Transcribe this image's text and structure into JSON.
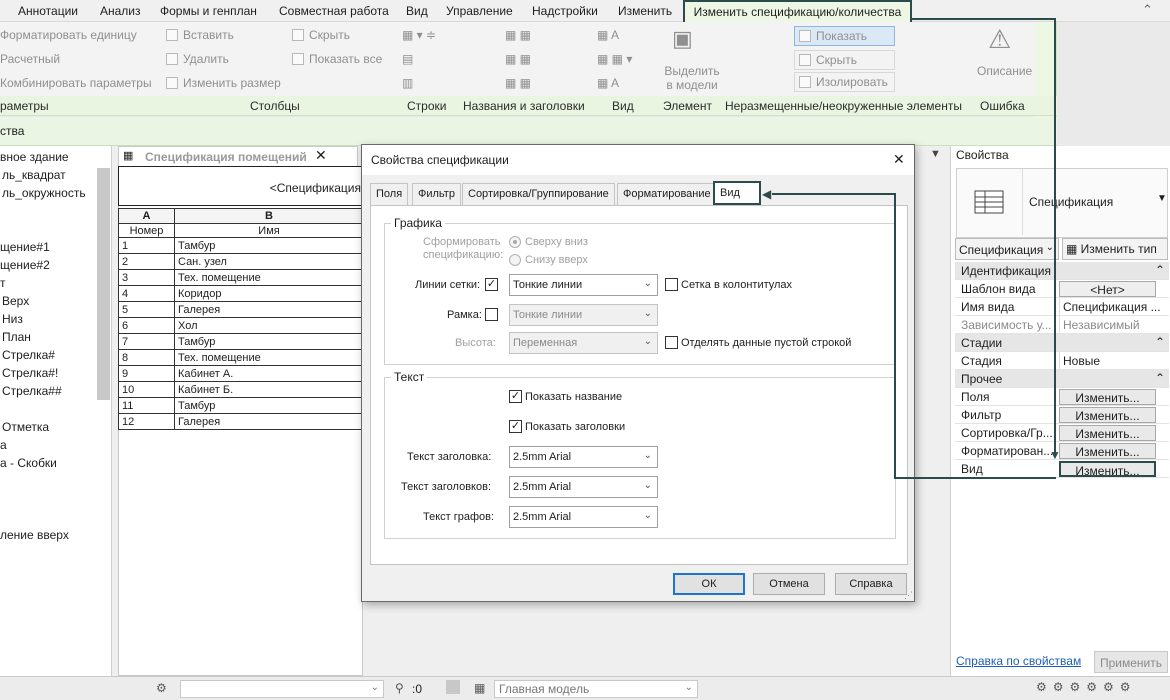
{
  "menu": {
    "items": [
      "Аннотации",
      "Анализ",
      "Формы и генплан",
      "Совместная работа",
      "Вид",
      "Управление",
      "Надстройки",
      "Изменить"
    ],
    "active": "Изменить спецификацию/количества"
  },
  "ribbon": {
    "params": [
      "Форматировать единицу",
      "Расчетный",
      "Комбинировать параметры"
    ],
    "columns": [
      "Вставить",
      "Удалить",
      "Изменить размер"
    ],
    "columns2": [
      "Скрыть",
      "Показать все"
    ],
    "element": "Выделить в модели",
    "unplaced": [
      "Показать",
      "Скрыть",
      "Изолировать"
    ],
    "error": "Описание",
    "group_labels": [
      "раметры",
      "Столбцы",
      "Строки",
      "Названия и заголовки",
      "Вид",
      "Элемент",
      "Неразмещенные/неокруженные элементы",
      "Ошибка"
    ],
    "context": "ства"
  },
  "left_panel": {
    "items": [
      "вное здание",
      "ль_квадрат",
      "ль_окружность",
      "щение#1",
      "щение#2",
      "т",
      "Верх",
      "Низ",
      "План",
      "Стрелка#",
      "Стрелка#!",
      "Стрелка##",
      "Отметка",
      "а",
      "а - Скобки",
      "ление вверх"
    ]
  },
  "schedule": {
    "tab_label": "Спецификация помещений",
    "title": "<Спецификация",
    "col_letters": [
      "A",
      "B"
    ],
    "col_headers": [
      "Номер",
      "Имя"
    ],
    "rows": [
      [
        "1",
        "Тамбур"
      ],
      [
        "2",
        "Сан. узел"
      ],
      [
        "3",
        "Тех. помещение"
      ],
      [
        "4",
        "Коридор"
      ],
      [
        "5",
        "Галерея"
      ],
      [
        "6",
        "Хол"
      ],
      [
        "7",
        "Тамбур"
      ],
      [
        "8",
        "Тех. помещение"
      ],
      [
        "9",
        "Кабинет А."
      ],
      [
        "10",
        "Кабинет Б."
      ],
      [
        "11",
        "Тамбур"
      ],
      [
        "12",
        "Галерея"
      ]
    ]
  },
  "dialog": {
    "title": "Свойства спецификации",
    "tabs": [
      "Поля",
      "Фильтр",
      "Сортировка/Группирование",
      "Форматирование",
      "Вид"
    ],
    "active_tab": "Вид",
    "graphics": {
      "group": "Графика",
      "build_label": "Сформировать спецификацию:",
      "build_top": "Сверху вниз",
      "build_bottom": "Снизу вверх",
      "grid_label": "Линии сетки:",
      "grid_value": "Тонкие линии",
      "grid_headers": "Сетка в колонтитулах",
      "frame_label": "Рамка:",
      "frame_value": "Тонкие линии",
      "height_label": "Высота:",
      "height_value": "Переменная",
      "blank_row": "Отделять данные пустой строкой"
    },
    "text": {
      "group": "Текст",
      "show_title": "Показать название",
      "show_headers": "Показать заголовки",
      "title_text_label": "Текст заголовка:",
      "title_text_value": "2.5mm Arial",
      "headers_text_label": "Текст заголовков:",
      "headers_text_value": "2.5mm Arial",
      "body_text_label": "Текст графов:",
      "body_text_value": "2.5mm Arial"
    },
    "buttons": {
      "ok": "ОК",
      "cancel": "Отмена",
      "help": "Справка"
    }
  },
  "properties": {
    "title": "Свойства",
    "type_name": "Спецификация",
    "type_selector": "Спецификация",
    "edit_type": "Изменить тип",
    "groups": {
      "identity": "Идентификация",
      "stages": "Стадии",
      "other": "Прочее"
    },
    "rows": {
      "template_k": "Шаблон вида",
      "template_v": "<Нет>",
      "viewname_k": "Имя вида",
      "viewname_v": "Спецификация ...",
      "depend_k": "Зависимость у...",
      "depend_v": "Независимый",
      "stage_k": "Стадия",
      "stage_v": "Новые",
      "fields_k": "Поля",
      "filter_k": "Фильтр",
      "sort_k": "Сортировка/Гр...",
      "format_k": "Форматирован...",
      "view_k": "Вид",
      "edit_label": "Изменить..."
    },
    "help_link": "Справка по свойствам",
    "apply": "Применить"
  },
  "status": {
    "coords": ":0",
    "model": "Главная модель"
  },
  "colors": {
    "accent": "#2b4a4a",
    "context_green": "#eaf6e3",
    "ok_border": "#1e74d2"
  }
}
